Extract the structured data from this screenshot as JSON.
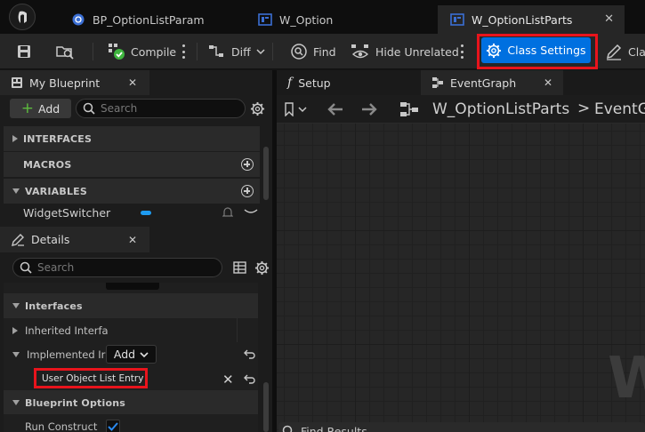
{
  "tabs": [
    {
      "label": "BP_OptionListParam",
      "icon": "blueprint-icon"
    },
    {
      "label": "W_Option",
      "icon": "widget-blueprint-icon"
    },
    {
      "label": "W_OptionListParts",
      "icon": "widget-blueprint-icon",
      "active": true
    }
  ],
  "toolbar": {
    "compile": "Compile",
    "diff": "Diff",
    "find": "Find",
    "hide_unrelated": "Hide Unrelated",
    "class_settings": "Class Settings",
    "class_defaults": "Clas"
  },
  "my_blueprint": {
    "title": "My Blueprint",
    "add": "Add",
    "search_placeholder": "Search",
    "sections": {
      "interfaces": "INTERFACES",
      "macros": "MACROS",
      "variables": "VARIABLES"
    },
    "variable": "WidgetSwitcher"
  },
  "details": {
    "title": "Details",
    "search_placeholder": "Search",
    "section_interfaces": "Interfaces",
    "inherited": "Inherited Interfa",
    "implemented": "Implemented Ir",
    "add_dropdown": "Add",
    "interface_entry": "User Object List Entry",
    "section_blueprint_options": "Blueprint Options",
    "run_construction": "Run Construct",
    "run_construction_checked": true
  },
  "graph_tabs": {
    "setup": "Setup",
    "event_graph": "EventGraph"
  },
  "breadcrumb": {
    "root": "W_OptionListParts",
    "sep": ">",
    "current": "EventG"
  },
  "graph": {
    "watermark": "W"
  },
  "find_results": {
    "title": "Find Results"
  },
  "colors": {
    "accent": "#0070E0",
    "highlight": "#E8141C",
    "variable_pill": "#1E9BF0",
    "checkbox": "#0070E0"
  }
}
